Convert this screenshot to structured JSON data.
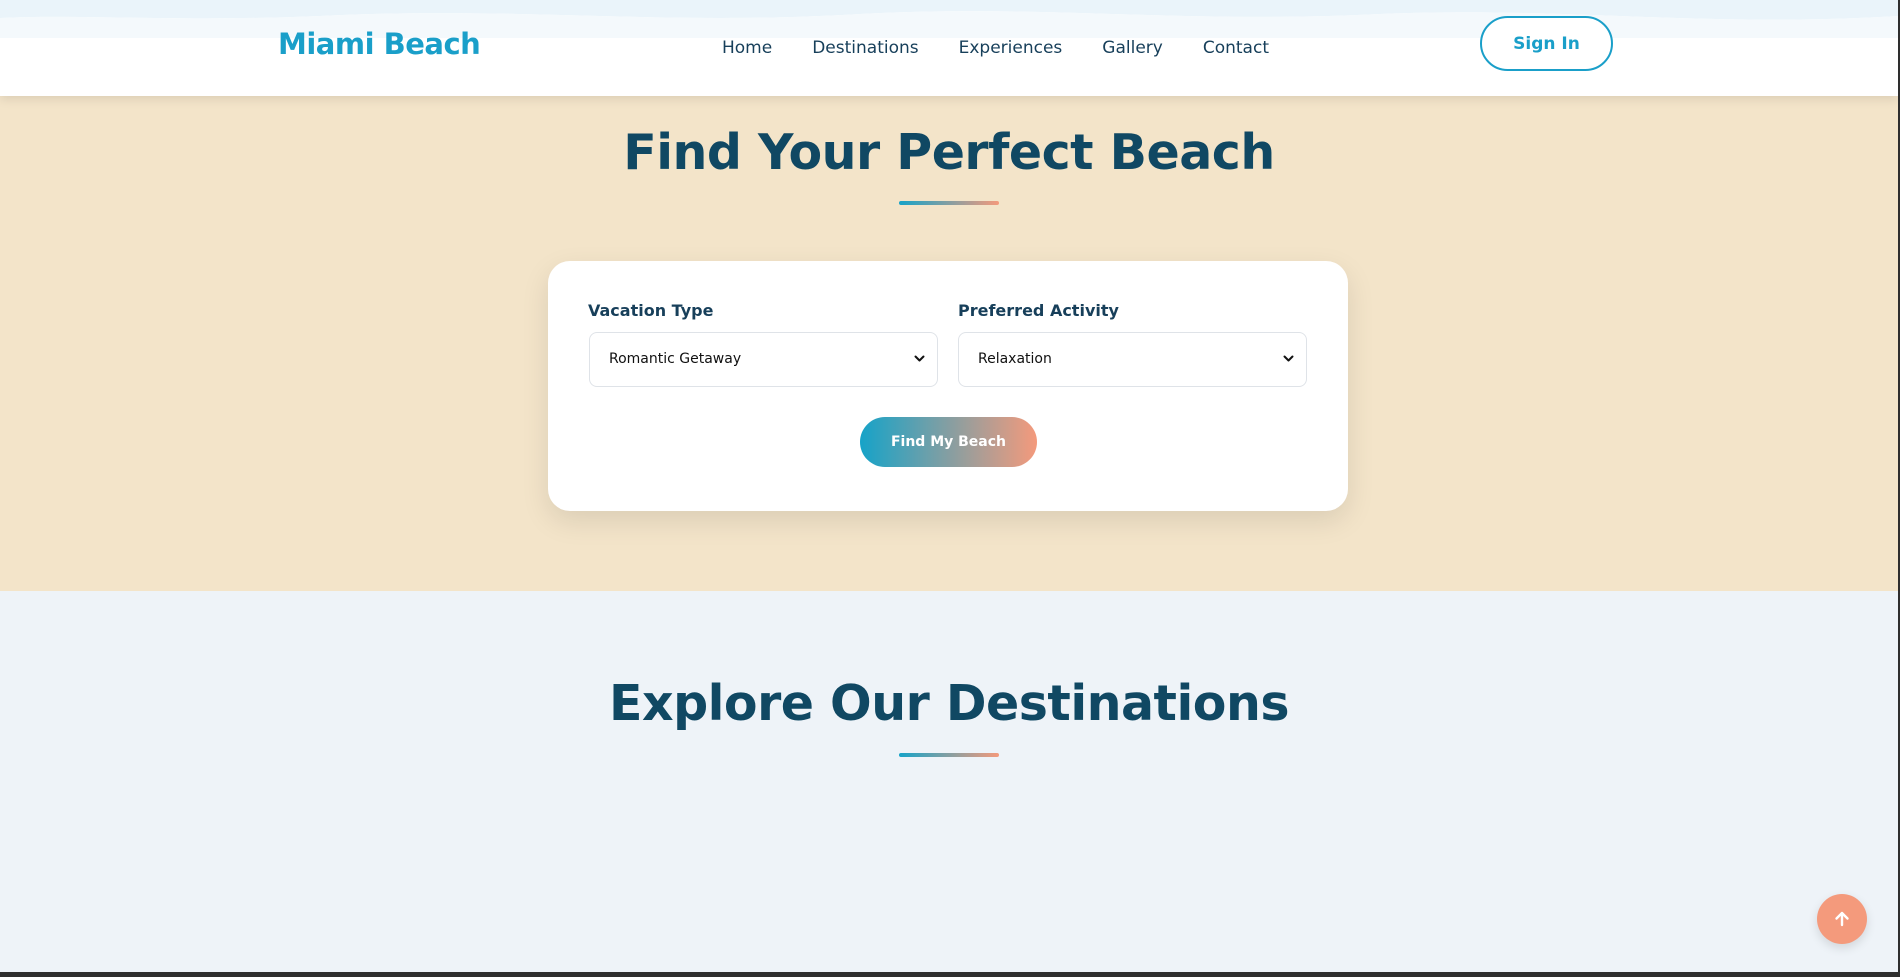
{
  "header": {
    "logo": "Miami Beach",
    "nav": [
      {
        "label": "Home"
      },
      {
        "label": "Destinations"
      },
      {
        "label": "Experiences"
      },
      {
        "label": "Gallery"
      },
      {
        "label": "Contact"
      }
    ],
    "sign_in_label": "Sign In"
  },
  "finder": {
    "title": "Find Your Perfect Beach",
    "vacation_type": {
      "label": "Vacation Type",
      "selected": "Romantic Getaway"
    },
    "preferred_activity": {
      "label": "Preferred Activity",
      "selected": "Relaxation"
    },
    "button_label": "Find My Beach"
  },
  "destinations": {
    "title": "Explore Our Destinations"
  },
  "scroll_top": {
    "icon": "arrow-up-icon"
  },
  "colors": {
    "brand": "#1a9fc9",
    "heading": "#104863",
    "sand": "#f3e4c9",
    "coral": "#f49a7c",
    "light_bg": "#eef3f8"
  }
}
